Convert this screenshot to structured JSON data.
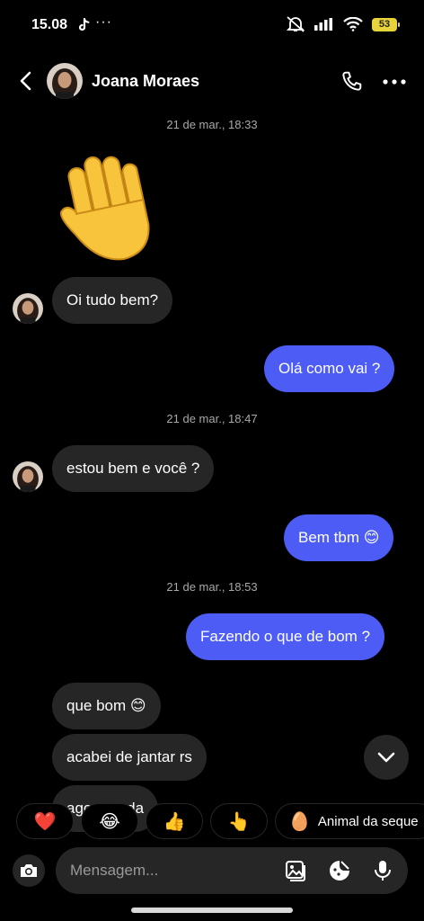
{
  "status_bar": {
    "time": "15.08",
    "dots": "···",
    "battery": "53"
  },
  "header": {
    "contact_name": "Joana Moraes"
  },
  "timestamps": [
    "21 de mar., 18:33",
    "21 de mar., 18:47",
    "21 de mar., 18:53"
  ],
  "messages": [
    {
      "direction": "in",
      "text": "Oi tudo bem?"
    },
    {
      "direction": "out",
      "text": "Olá como vai ?"
    },
    {
      "direction": "in",
      "text": "estou bem e você ?"
    },
    {
      "direction": "out",
      "text": "Bem tbm 😊"
    },
    {
      "direction": "out",
      "text": "Fazendo o que de bom ?"
    },
    {
      "direction": "in",
      "text": "que bom 😊"
    },
    {
      "direction": "in",
      "text": "acabei de jantar rs"
    },
    {
      "direction": "in",
      "text": "agora nada"
    }
  ],
  "quick_reactions": {
    "heart": "❤️",
    "laugh": "😂",
    "thumbs_up": "👍",
    "point": "👆",
    "egg": "🥚",
    "animal_label": "Animal da seque"
  },
  "composer": {
    "placeholder": "Mensagem..."
  },
  "colors": {
    "background": "#000000",
    "incoming_bubble": "#262626",
    "outgoing_bubble": "#4c5cf4",
    "timestamp": "#a8a8a8",
    "battery": "#e8d33a"
  }
}
